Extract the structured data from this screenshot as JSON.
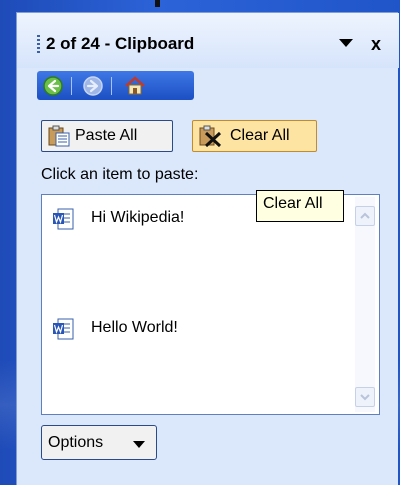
{
  "pane": {
    "title": "2 of 24 - Clipboard",
    "menu_icon": "dropdown-arrow-icon",
    "close_label": "x"
  },
  "navbar": {
    "back_icon": "back-arrow-icon",
    "forward_icon": "forward-arrow-icon",
    "home_icon": "home-icon"
  },
  "toolbar": {
    "paste_all_label": "Paste All",
    "clear_all_label": "Clear All"
  },
  "prompt": "Click an item to paste:",
  "items": [
    {
      "text": "Hi Wikipedia!",
      "icon": "word-document-icon"
    },
    {
      "text": "Hello World!",
      "icon": "word-document-icon"
    }
  ],
  "tooltip": "Clear All",
  "options_label": "Options",
  "colors": {
    "desktop_blue": "#2a5fd0",
    "pane_bg": "#dbe7fb",
    "nav_blue": "#1b4fc3",
    "clear_highlight": "#fde4a3",
    "tooltip_bg": "#ffffe1"
  }
}
